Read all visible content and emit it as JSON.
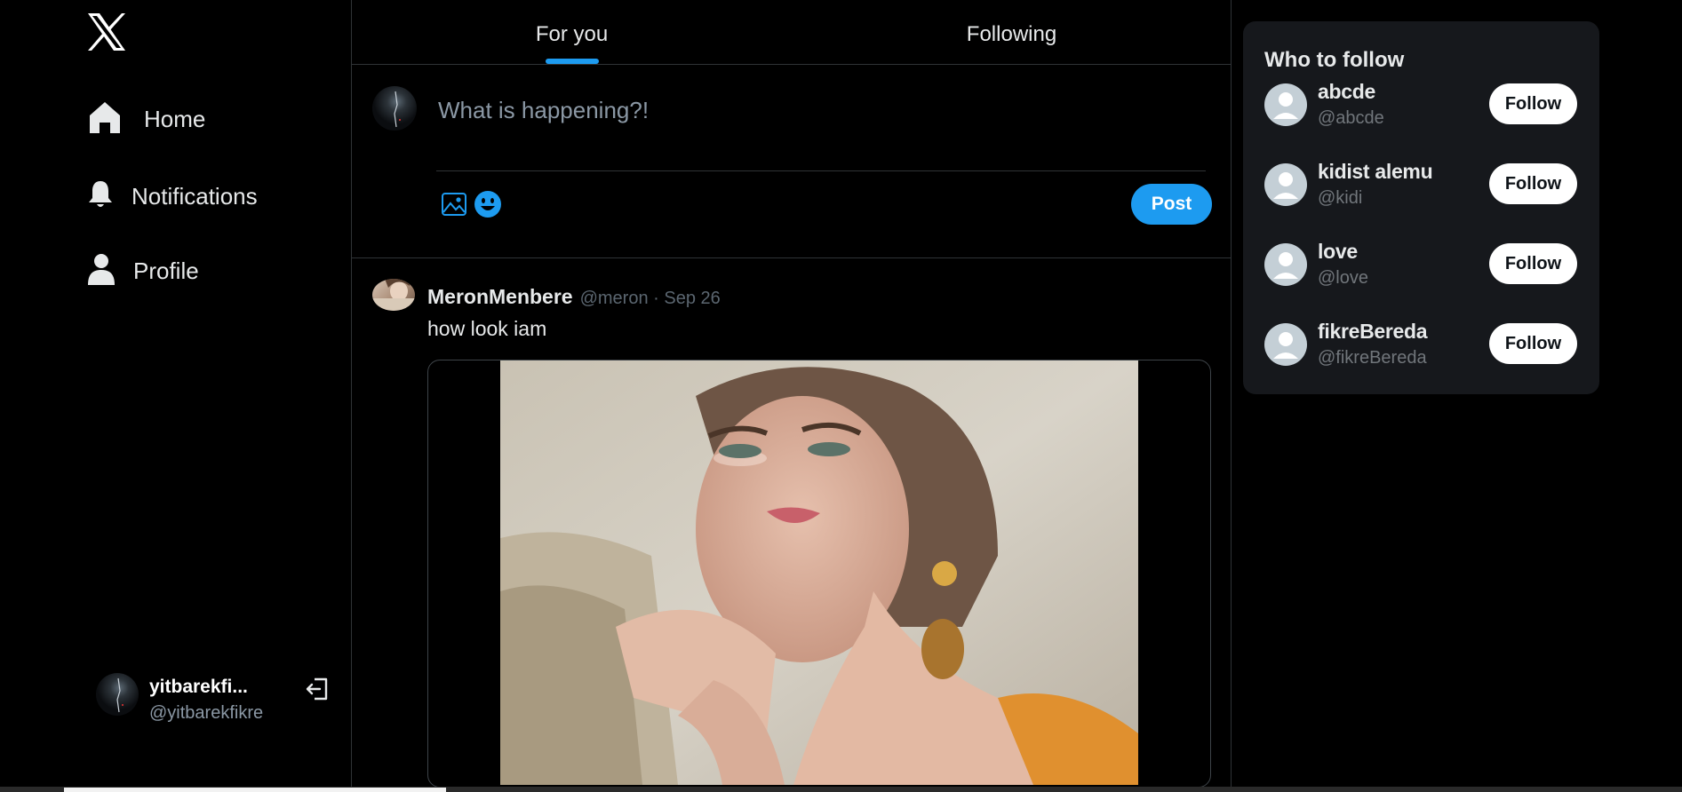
{
  "nav": {
    "home": "Home",
    "notifications": "Notifications",
    "profile": "Profile"
  },
  "account": {
    "name": "yitbarekfi...",
    "handle": "@yitbarekfikre"
  },
  "tabs": [
    "For you",
    "Following"
  ],
  "composer": {
    "placeholder": "What is happening?!",
    "post_label": "Post"
  },
  "tweet": {
    "author": "MeronMenbere",
    "handle": "@meron",
    "date": "Sep 26",
    "meta": "@meron · Sep 26",
    "text": "how look iam"
  },
  "who_to_follow": {
    "title": "Who to follow",
    "users": [
      {
        "name": "abcde",
        "handle": "@abcde",
        "button": "Follow"
      },
      {
        "name": "kidist alemu",
        "handle": "@kidi",
        "button": "Follow"
      },
      {
        "name": "love",
        "handle": "@love",
        "button": "Follow"
      },
      {
        "name": "fikreBereda",
        "handle": "@fikreBereda",
        "button": "Follow"
      }
    ]
  },
  "colors": {
    "accent": "#1d9bf0",
    "background": "#000000",
    "card": "#16181c"
  }
}
